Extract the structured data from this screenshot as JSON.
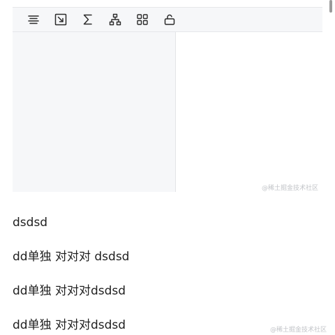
{
  "toolbar": {
    "icons": [
      "align-lines-icon",
      "fit-screen-icon",
      "sigma-icon",
      "hierarchy-icon",
      "grid-icon",
      "lock-icon"
    ]
  },
  "watermark": {
    "top": "@稀土掘金技术社区",
    "bottom": "@稀土掘金技术社区"
  },
  "content": {
    "paragraphs": [
      "dsdsd",
      "dd单独 对对对 dsdsd",
      "dd单独 对对对dsdsd",
      "dd单独 对对对dsdsd"
    ]
  },
  "colors": {
    "toolbar_bg": "#f6f7f9",
    "icon": "#2b2b2b",
    "text": "#1f1f1f",
    "watermark": "#c2c4c8"
  }
}
